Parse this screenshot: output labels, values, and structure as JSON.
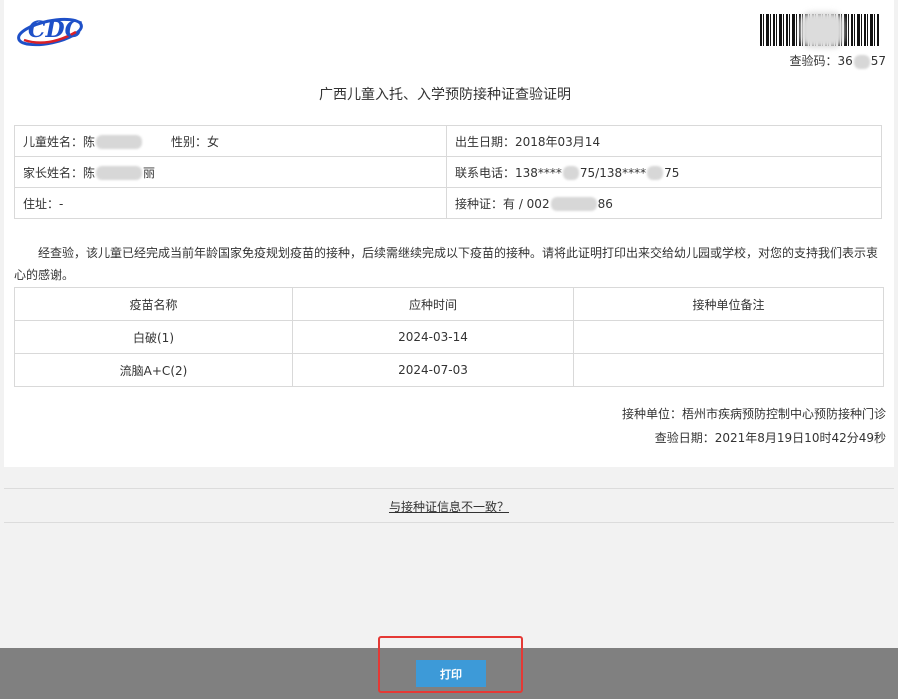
{
  "header": {
    "logo_text": "CDC",
    "barcode_icon": "barcode-icon",
    "check_code": "查验码：36",
    "check_code_suffix": "57"
  },
  "title": "广西儿童入托、入学预防接种证查验证明",
  "info": {
    "child_name_label": "儿童姓名：",
    "child_name_visible": "陈",
    "gender": "性别：女",
    "birth_date": "出生日期：2018年03月14",
    "parent_name_label": "家长姓名：",
    "parent_name_prefix": "陈",
    "parent_name_suffix": "丽",
    "phone": "联系电话：138****",
    "phone_mid": "75/138****",
    "phone_end": "75",
    "address": "住址：-",
    "certificate_prefix": "接种证：有 / 002",
    "certificate_suffix": "86"
  },
  "notice": "经查验，该儿童已经完成当前年龄国家免疫规划疫苗的接种，后续需继续完成以下疫苗的接种。请将此证明打印出来交给幼儿园或学校，对您的支持我们表示衷心的感谢。",
  "vaccines": {
    "headers": [
      "疫苗名称",
      "应种时间",
      "接种单位备注"
    ],
    "rows": [
      {
        "name": "白破(1)",
        "time": "2024-03-14",
        "note": ""
      },
      {
        "name": "流脑A+C(2)",
        "time": "2024-07-03",
        "note": ""
      }
    ]
  },
  "footer_info": {
    "unit": "接种单位：梧州市疾病预防控制中心预防接种门诊",
    "check_date": "查验日期：2021年8月19日10时42分49秒"
  },
  "mismatch_link": "与接种证信息不一致？",
  "print_button": "打印",
  "colors": {
    "logo_blue": "#1e50c8",
    "logo_red": "#d92027",
    "print_button": "#3d9ad8",
    "footer_bar": "#808080",
    "highlight": "#e53935"
  }
}
